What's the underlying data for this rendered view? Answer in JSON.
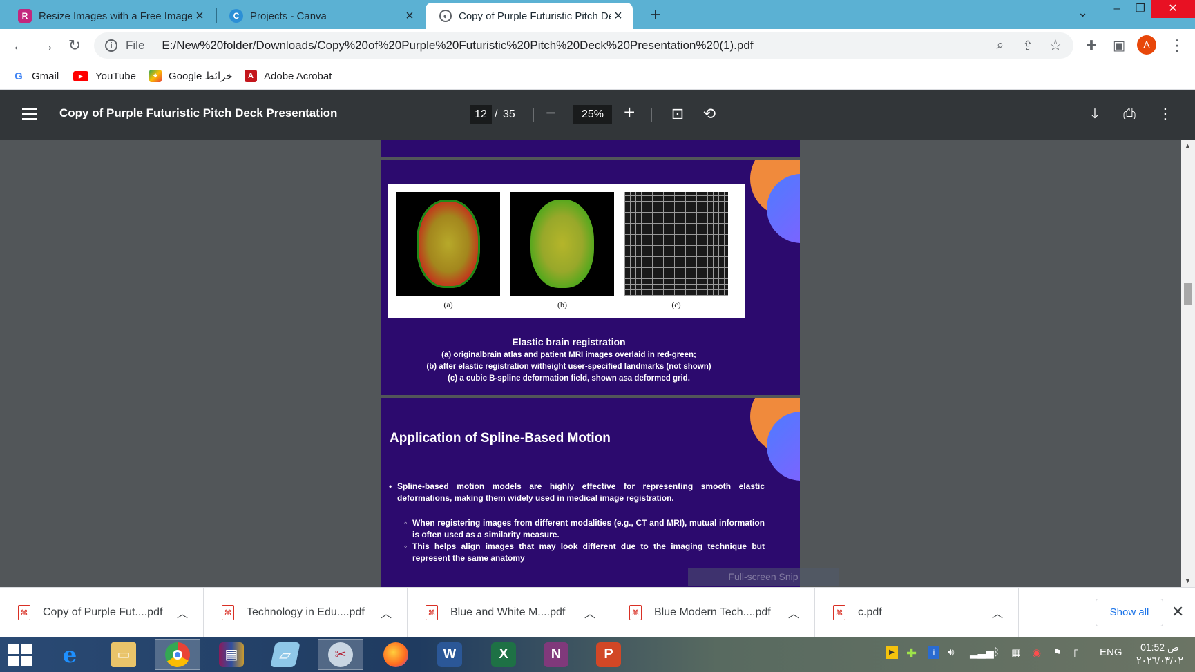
{
  "browser": {
    "tabs": [
      {
        "title": "Resize Images with a Free Image",
        "favicon": "R",
        "favicon_color": "#c3267d",
        "active": false
      },
      {
        "title": "Projects - Canva",
        "favicon": "C",
        "favicon_color": "#2b8fd6",
        "active": false
      },
      {
        "title": "Copy of Purple Futuristic Pitch De",
        "favicon": "globe",
        "favicon_color": "#5f6368",
        "active": true
      }
    ],
    "new_tab_label": "+",
    "address": {
      "scheme": "File",
      "url": "E:/New%20folder/Downloads/Copy%20of%20Purple%20Futuristic%20Pitch%20Deck%20Presentation%20(1).pdf"
    },
    "profile_initial": "A",
    "bookmarks": [
      {
        "label": "Gmail",
        "icon": "google-icon"
      },
      {
        "label": "YouTube",
        "icon": "youtube-icon"
      },
      {
        "label": "Google خرائط",
        "icon": "maps-icon"
      },
      {
        "label": "Adobe Acrobat",
        "icon": "acrobat-icon"
      }
    ]
  },
  "pdf_viewer": {
    "title": "Copy of Purple Futuristic Pitch Deck Presentation",
    "current_page": "12",
    "page_separator": "/",
    "total_pages": "35",
    "zoom": "25%"
  },
  "slide_figure": {
    "labels": [
      "(a)",
      "(b)",
      "(c)"
    ],
    "caption_title": "Elastic brain registration",
    "caption_lines": [
      "(a) originalbrain atlas and patient MRI images overlaid in red-green;",
      "(b) after elastic registration witheight user-specified landmarks (not shown)",
      "(c) a cubic B-spline deformation field, shown asa deformed grid."
    ]
  },
  "slide_motion": {
    "title": "Application of Spline-Based Motion",
    "bullet": "Spline-based motion models are highly effective for representing smooth elastic deformations, making them widely used in medical image registration.",
    "sub_bullets": [
      "When registering images from different modalities (e.g., CT and MRI), mutual information is often used as a similarity measure.",
      "This helps align images that may look different due to the imaging technique but represent the same anatomy"
    ]
  },
  "overlay_text": "Full-screen Snip",
  "downloads": [
    {
      "name": "Copy of Purple Fut....pdf"
    },
    {
      "name": "Technology in Edu....pdf"
    },
    {
      "name": "Blue and White M....pdf"
    },
    {
      "name": "Blue Modern Tech....pdf"
    },
    {
      "name": "c.pdf"
    }
  ],
  "downloads_show_all": "Show all",
  "taskbar": {
    "apps": [
      "internet-explorer-icon",
      "file-explorer-icon",
      "chrome-icon",
      "winrar-icon",
      "notepad-icon",
      "snipping-tool-icon",
      "firefox-icon",
      "word-icon",
      "excel-icon",
      "onenote-icon",
      "powerpoint-icon"
    ],
    "language": "ENG",
    "time": "01:52 ص",
    "date": "٢٠٢٦/٠٣/٠٢"
  }
}
